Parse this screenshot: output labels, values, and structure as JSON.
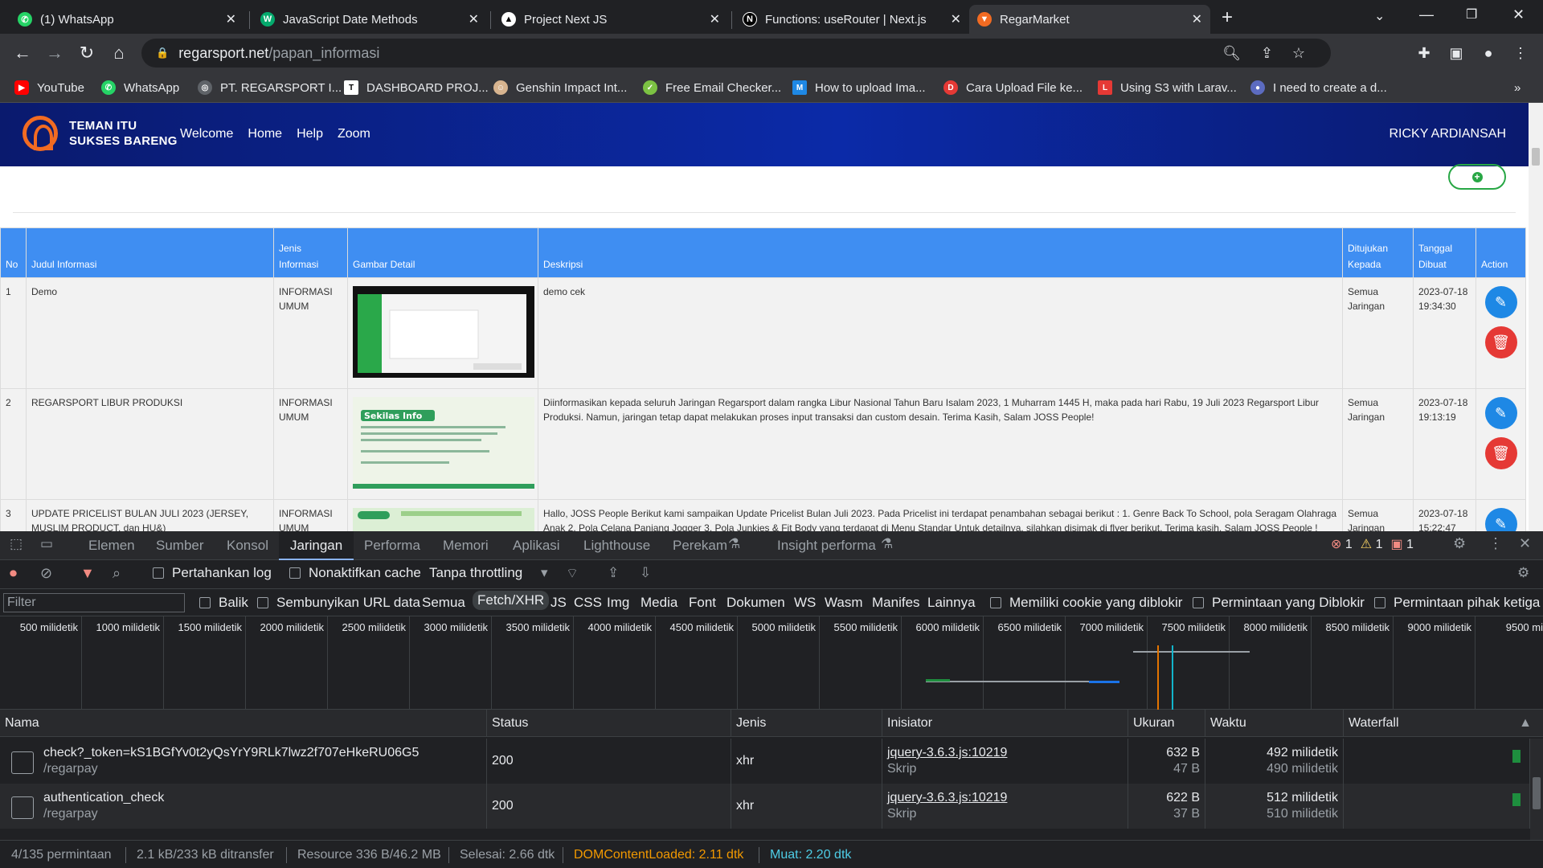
{
  "browser": {
    "tabs": [
      {
        "title": "(1) WhatsApp",
        "icon": "whatsapp-icon",
        "color": "#25d366"
      },
      {
        "title": "JavaScript Date Methods",
        "icon": "w3schools-icon",
        "color": "#04aa6d"
      },
      {
        "title": "Project Next JS",
        "icon": "vercel-icon",
        "color": "#ffffff"
      },
      {
        "title": "Functions: useRouter | Next.js",
        "icon": "nextjs-icon",
        "color": "#000000"
      },
      {
        "title": "RegarMarket",
        "icon": "regar-icon",
        "color": "#f26b22"
      }
    ],
    "url_host": "regarsport.net",
    "url_path": "/papan_informasi",
    "bookmarks": [
      {
        "label": "YouTube",
        "color": "#ff0000"
      },
      {
        "label": "WhatsApp",
        "color": "#25d366"
      },
      {
        "label": "PT. REGARSPORT I...",
        "color": "#9aa0a6"
      },
      {
        "label": "DASHBOARD PROJ...",
        "color": "#ffffff"
      },
      {
        "label": "Genshin Impact Int...",
        "color": "#d7b48f"
      },
      {
        "label": "Free Email Checker...",
        "color": "#7cc243"
      },
      {
        "label": "How to upload Ima...",
        "color": "#1e88e5"
      },
      {
        "label": "Cara Upload File ke...",
        "color": "#e53935"
      },
      {
        "label": "Using S3 with Larav...",
        "color": "#e53935"
      },
      {
        "label": "I need to create a d...",
        "color": "#5c6bc0"
      }
    ]
  },
  "site": {
    "brand_line1": "TEMAN ITU",
    "brand_line2": "SUKSES BARENG",
    "nav": [
      "Welcome",
      "Home",
      "Help",
      "Zoom"
    ],
    "user": "RICKY ARDIANSAH",
    "table_headers": [
      "No",
      "Judul Informasi",
      "Jenis Informasi",
      "Gambar Detail",
      "Deskripsi",
      "Ditujukan Kepada",
      "Tanggal Dibuat",
      "Action"
    ],
    "rows": [
      {
        "no": "1",
        "judul": "Demo",
        "jenis": "INFORMASI UMUM",
        "deskripsi": "demo cek",
        "kepada": "Semua Jaringan",
        "tanggal": "2023-07-18 19:34:30"
      },
      {
        "no": "2",
        "judul": "REGARSPORT LIBUR PRODUKSI",
        "jenis": "INFORMASI UMUM",
        "deskripsi": "Diinformasikan kepada seluruh Jaringan Regarsport dalam rangka Libur Nasional Tahun Baru Isalam 2023, 1 Muharram 1445 H, maka pada hari Rabu, 19 Juli 2023 Regarsport Libur Produksi. Namun, jaringan tetap dapat melakukan proses input transaksi dan custom desain. Terima Kasih, Salam JOSS People!",
        "kepada": "Semua Jaringan",
        "tanggal": "2023-07-18 19:13:19"
      },
      {
        "no": "3",
        "judul": "UPDATE PRICELIST BULAN JULI 2023 (JERSEY, MUSLIM PRODUCT, dan HU&)",
        "jenis": "INFORMASI UMUM",
        "deskripsi": "Hallo, JOSS People Berikut kami sampaikan Update Pricelist Bulan Juli 2023. Pada Pricelist ini terdapat penambahan sebagai berikut : 1. Genre Back To School, pola Seragam Olahraga Anak 2. Pola Celana Panjang Jogger 3. Pola Junkies & Fit Body yang terdapat di Menu Standar Untuk detailnya, silahkan disimak di flyer berikut. Terima kasih. Salam JOSS People !",
        "kepada": "Semua Jaringan",
        "tanggal": "2023-07-18 15:22:47"
      }
    ],
    "thumb2_title": "Sekilas Info"
  },
  "devtools": {
    "tabs": [
      "Elemen",
      "Sumber",
      "Konsol",
      "Jaringan",
      "Performa",
      "Memori",
      "Aplikasi",
      "Lighthouse",
      "Perekam",
      "Insight performa"
    ],
    "errors": "1",
    "warnings": "1",
    "issues": "1",
    "preserve_log": "Pertahankan log",
    "disable_cache": "Nonaktifkan cache",
    "throttling": "Tanpa throttling",
    "filter_placeholder": "Filter",
    "filter_opts": [
      "Balik",
      "Sembunyikan URL data"
    ],
    "types": [
      "Semua",
      "Fetch/XHR",
      "JS",
      "CSS",
      "Img",
      "Media",
      "Font",
      "Dokumen",
      "WS",
      "Wasm",
      "Manifes",
      "Lainnya"
    ],
    "extra_filters": [
      "Memiliki cookie yang diblokir",
      "Permintaan yang Diblokir",
      "Permintaan pihak ketiga"
    ],
    "ticks": [
      "500 milidetik",
      "1000 milidetik",
      "1500 milidetik",
      "2000 milidetik",
      "2500 milidetik",
      "3000 milidetik",
      "3500 milidetik",
      "4000 milidetik",
      "4500 milidetik",
      "5000 milidetik",
      "5500 milidetik",
      "6000 milidetik",
      "6500 milidetik",
      "7000 milidetik",
      "7500 milidetik",
      "8000 milidetik",
      "8500 milidetik",
      "9000 milidetik",
      "9500 milid"
    ],
    "columns": [
      "Nama",
      "Status",
      "Jenis",
      "Inisiator",
      "Ukuran",
      "Waktu",
      "Waterfall"
    ],
    "requests": [
      {
        "name": "check?_token=kS1BGfYv0t2yQsYrY9RLk7lwz2f707eHkeRU06G5",
        "path": "/regarpay",
        "status": "200",
        "type": "xhr",
        "initiator": "jquery-3.6.3.js:10219",
        "initiator_type": "Skrip",
        "size": "632 B",
        "size2": "47 B",
        "time": "492 milidetik",
        "time2": "490 milidetik"
      },
      {
        "name": "authentication_check",
        "path": "/regarpay",
        "status": "200",
        "type": "xhr",
        "initiator": "jquery-3.6.3.js:10219",
        "initiator_type": "Skrip",
        "size": "622 B",
        "size2": "37 B",
        "time": "512 milidetik",
        "time2": "510 milidetik"
      }
    ],
    "status": {
      "requests": "4/135 permintaan",
      "transferred": "2.1 kB/233 kB ditransfer",
      "resource": "Resource 336 B/46.2 MB",
      "finish": "Selesai: 2.66 dtk",
      "dcl": "DOMContentLoaded: 2.11 dtk",
      "load": "Muat: 2.20 dtk"
    }
  }
}
